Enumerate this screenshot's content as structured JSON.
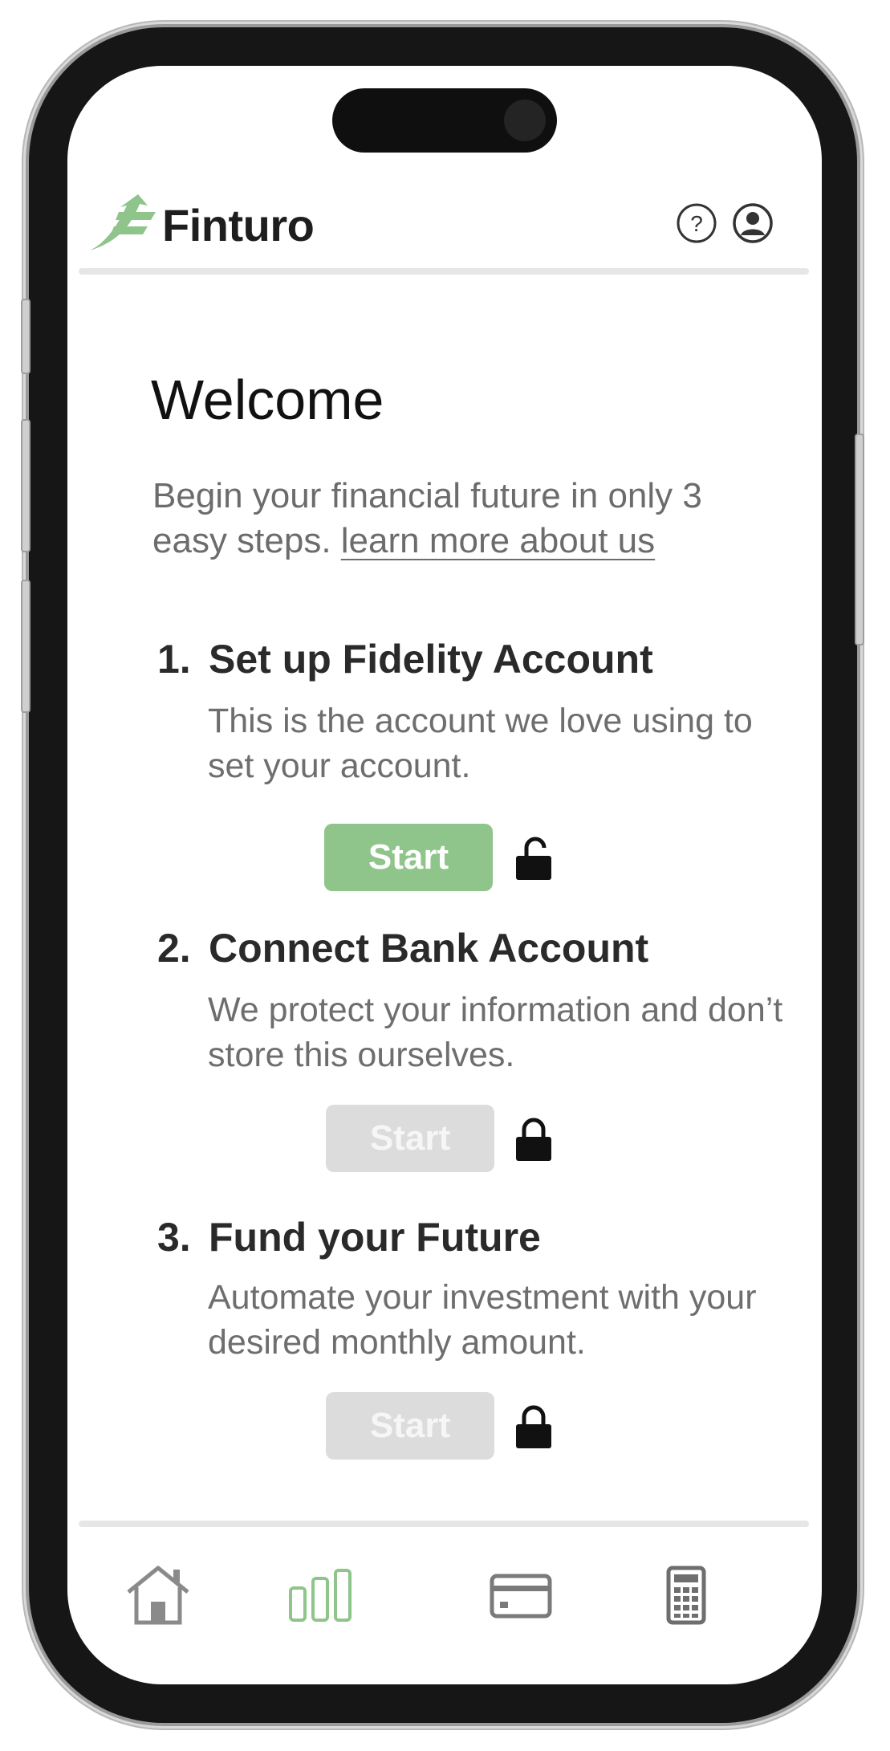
{
  "header": {
    "brand": "Finturo",
    "help_icon": "question-circle-icon",
    "profile_icon": "user-circle-icon"
  },
  "welcome": {
    "title": "Welcome",
    "intro_text": "Begin your financial future in only 3 easy steps. ",
    "learn_more_link": "learn more about us"
  },
  "steps": [
    {
      "number": "1.",
      "title": "Set up Fidelity Account",
      "description": "This is the account we love using to set your account.",
      "button_label": "Start",
      "button_state": "enabled",
      "lock_state": "unlocked"
    },
    {
      "number": "2.",
      "title": "Connect Bank Account",
      "description": "We protect your information and don’t store this ourselves.",
      "button_label": "Start",
      "button_state": "disabled",
      "lock_state": "locked"
    },
    {
      "number": "3.",
      "title": "Fund your Future",
      "description": "Automate your investment with your desired monthly amount.",
      "button_label": "Start",
      "button_state": "disabled",
      "lock_state": "locked"
    }
  ],
  "bottom_nav": [
    {
      "icon": "home-icon",
      "active": false
    },
    {
      "icon": "bar-chart-icon",
      "active": true
    },
    {
      "icon": "credit-card-icon",
      "active": false
    },
    {
      "icon": "calculator-icon",
      "active": false
    }
  ],
  "colors": {
    "accent": "#8fc48a",
    "disabled": "#dcdcdc",
    "text_dark": "#2a2a2a",
    "text_muted": "#6e6e6e",
    "icon_gray": "#7a7a7a"
  }
}
